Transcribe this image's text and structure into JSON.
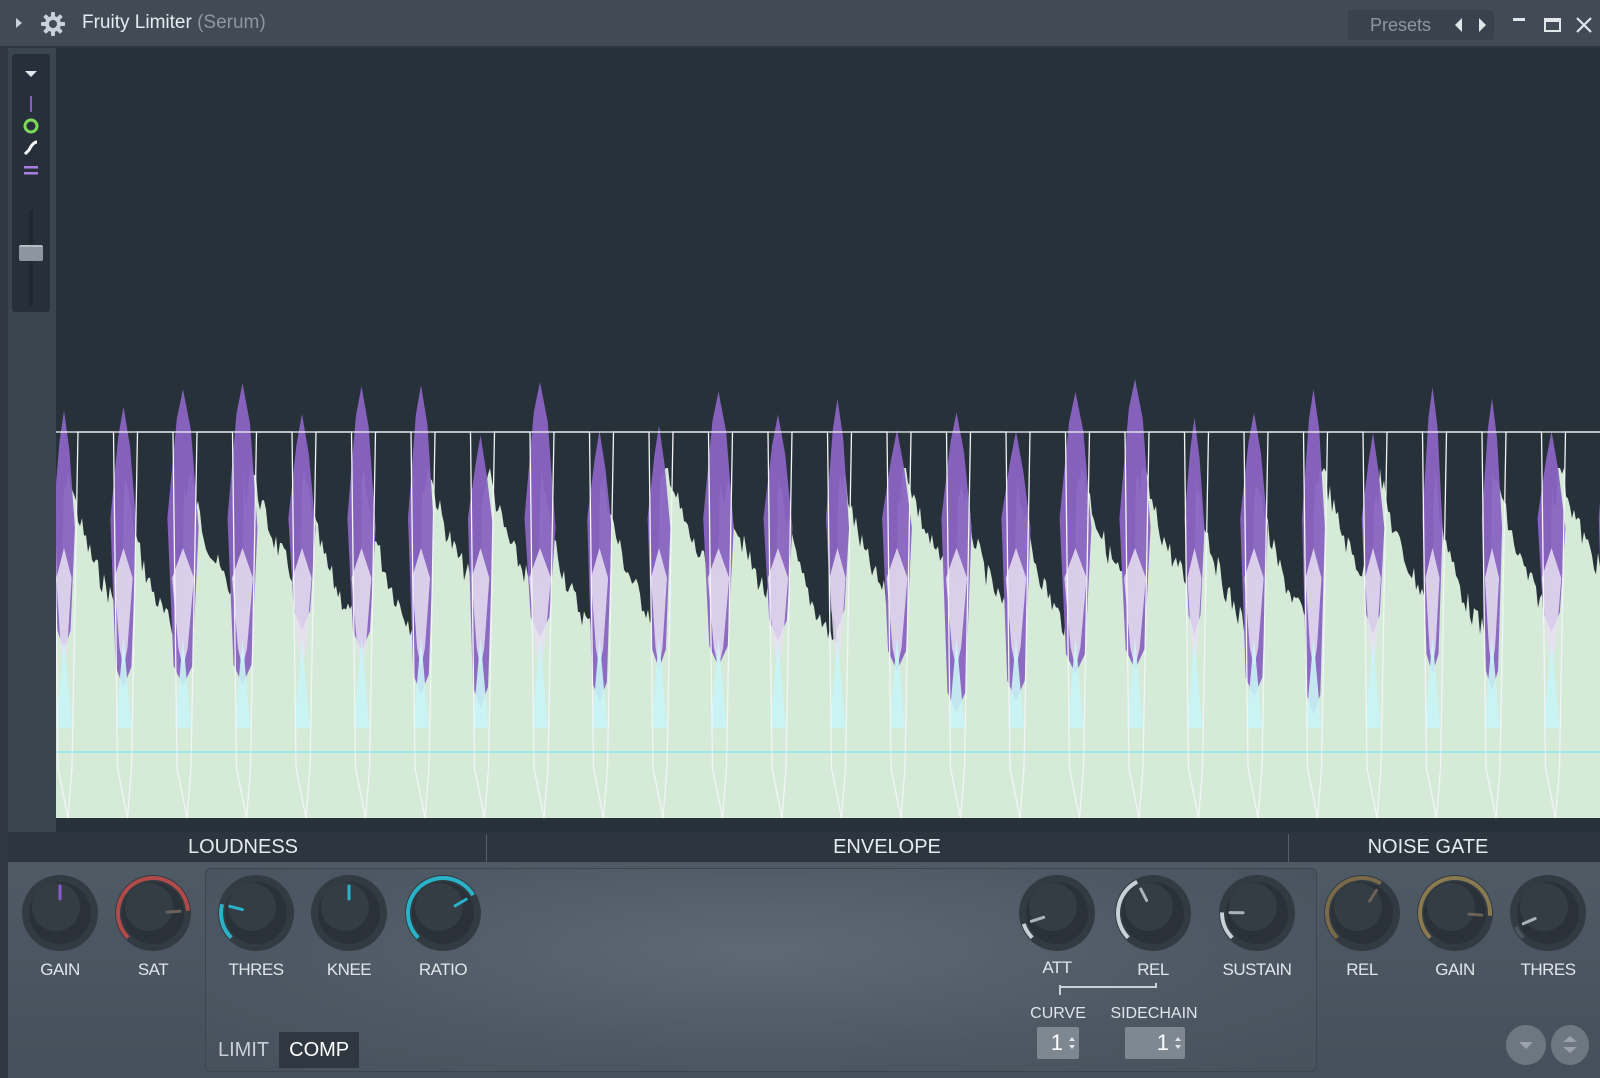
{
  "window": {
    "title": "Fruity Limiter",
    "subtitle": "(Serum)",
    "presets_label": "Presets"
  },
  "sections": {
    "loudness": "LOUDNESS",
    "envelope": "ENVELOPE",
    "noise_gate": "NOISE GATE"
  },
  "knobs": {
    "loudness_gain": {
      "label": "GAIN",
      "value": 0.5,
      "color": "#8a5cc8"
    },
    "loudness_sat": {
      "label": "SAT",
      "value": 0.82,
      "color": "#b24a4a"
    },
    "thres": {
      "label": "THRES",
      "value": 0.22,
      "color": "#2ab3c8"
    },
    "knee": {
      "label": "KNEE",
      "value": 0.5,
      "color": "#2ab3c8"
    },
    "ratio": {
      "label": "RATIO",
      "value": 0.72,
      "color": "#2ab3c8"
    },
    "att": {
      "label": "ATT",
      "value": 0.1,
      "color": "#c8d0d8"
    },
    "rel": {
      "label": "REL",
      "value": 0.4,
      "color": "#c8d0d8"
    },
    "sustain": {
      "label": "SUSTAIN",
      "value": 0.17,
      "color": "#c8d0d8"
    },
    "gate_rel": {
      "label": "REL",
      "value": 0.62,
      "color": "#7a6a4a"
    },
    "gate_gain": {
      "label": "GAIN",
      "value": 0.85,
      "color": "#8a7a50"
    },
    "gate_thres": {
      "label": "THRES",
      "value": 0.08,
      "color": "#4a5560"
    }
  },
  "modes": {
    "limit": "LIMIT",
    "comp": "COMP",
    "active": "COMP"
  },
  "curve": {
    "label": "CURVE",
    "value": "1"
  },
  "sidechain": {
    "label": "SIDECHAIN",
    "value": "1"
  },
  "colors": {
    "waveform_fill": "#d6ead8",
    "compression_purple": "#8a64c2",
    "peak_white": "#e8e0f2",
    "cyan_line": "#7fe6ee",
    "display_bg": "#27313a"
  }
}
